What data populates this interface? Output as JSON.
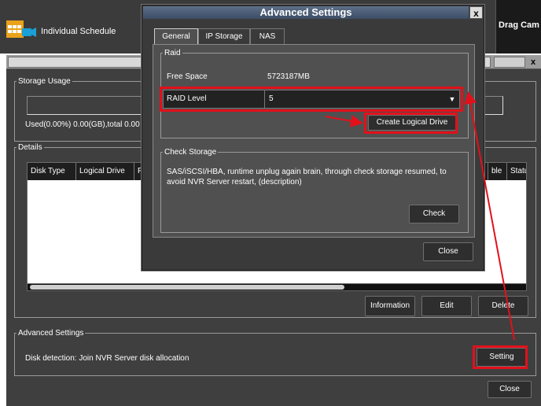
{
  "app": {
    "top_left_label": "Individual Schedule",
    "top_right_label": "Drag Cam",
    "close_x": "x"
  },
  "storage_usage": {
    "legend": "Storage Usage",
    "used_text": "Used(0.00%) 0.00(GB),total 0.00"
  },
  "details": {
    "legend": "Details",
    "columns": [
      "Disk Type",
      "Logical Drive",
      "F",
      "ble",
      "Status"
    ],
    "buttons": {
      "information": "Information",
      "edit": "Edit",
      "delete": "Delete"
    }
  },
  "advanced": {
    "legend": "Advanced Settings",
    "disk_detection": "Disk detection: Join NVR Server disk allocation",
    "setting_button": "Setting",
    "close_button": "Close"
  },
  "dialog": {
    "title": "Advanced Settings",
    "close_x": "x",
    "tabs": [
      {
        "label": "General",
        "active": true
      },
      {
        "label": "IP Storage",
        "active": false
      },
      {
        "label": "NAS",
        "active": false
      }
    ],
    "raid": {
      "legend": "Raid",
      "free_space_label": "Free Space",
      "free_space_value": "5723187MB",
      "raid_level_label": "RAID Level",
      "raid_level_value": "5",
      "dropdown_icon": "triangle-down-icon",
      "create_button": "Create Logical Drive"
    },
    "check": {
      "legend": "Check Storage",
      "description": "SAS/iSCSI/HBA, runtime unplug again brain, through check storage resumed, to avoid NVR Server restart, (description)",
      "check_button": "Check"
    },
    "close_button": "Close"
  },
  "colors": {
    "highlight": "#e3101a",
    "dialog_title_bar": "#4b5d78",
    "panel_bg": "#3f3f3f"
  }
}
